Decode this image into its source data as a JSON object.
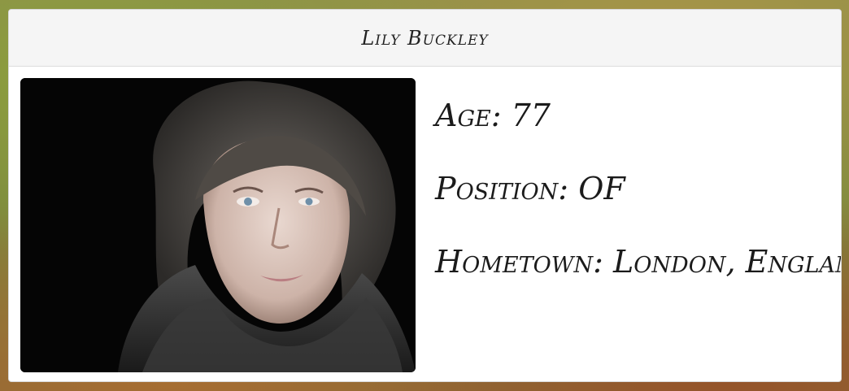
{
  "player": {
    "name": "Lily Buckley",
    "photo_alt": "Lily Buckley",
    "age_label": "Age:",
    "age": "77",
    "position_label": "Position:",
    "position": "OF",
    "hometown_label": "Hometown:",
    "hometown": "London, England"
  }
}
